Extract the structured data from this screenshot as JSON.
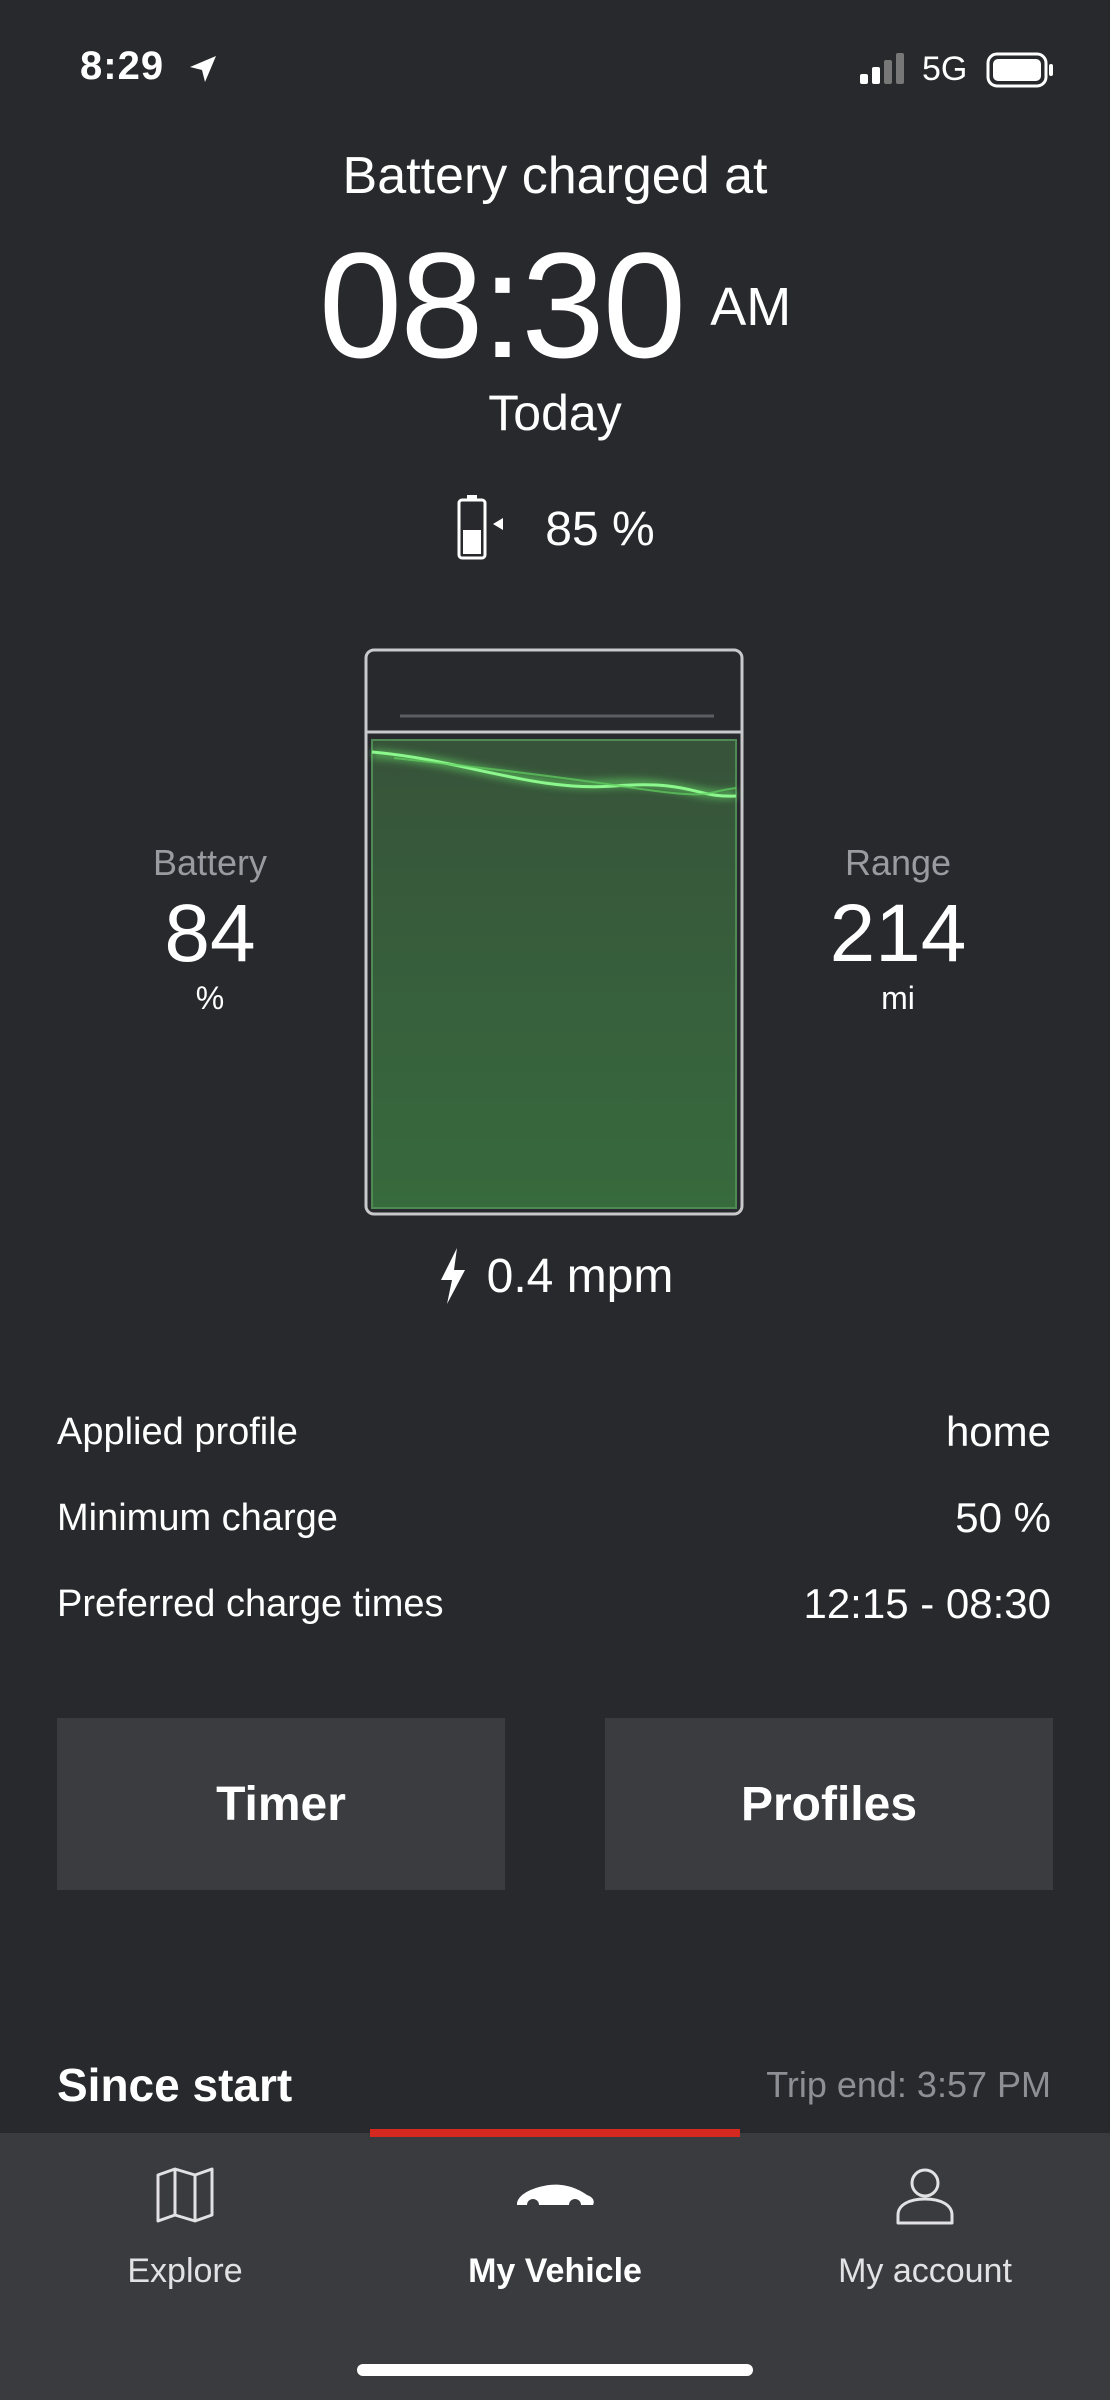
{
  "status_bar": {
    "time": "8:29",
    "network": "5G"
  },
  "header": {
    "title": "Battery charged at",
    "time": "08:30",
    "ampm": "AM",
    "day": "Today",
    "target_charge": "85 %"
  },
  "battery": {
    "label": "Battery",
    "value": "84",
    "unit": "%",
    "level": 0.84
  },
  "range": {
    "label": "Range",
    "value": "214",
    "unit": "mi"
  },
  "charge_rate": "0.4 mpm",
  "info": [
    {
      "label": "Applied profile",
      "value": "home"
    },
    {
      "label": "Minimum charge",
      "value": "50 %"
    },
    {
      "label": "Preferred charge times",
      "value": "12:15 - 08:30"
    }
  ],
  "buttons": {
    "timer": "Timer",
    "profiles": "Profiles"
  },
  "since": {
    "title": "Since start",
    "trip_end": "Trip end: 3:57 PM"
  },
  "nav": [
    {
      "label": "Explore",
      "icon": "map-icon",
      "active": false
    },
    {
      "label": "My Vehicle",
      "icon": "car-icon",
      "active": true
    },
    {
      "label": "My account",
      "icon": "person-icon",
      "active": false
    }
  ],
  "colors": {
    "accent": "#d5281e",
    "charge_green": "#3a6a40",
    "glow": "#6cf06c"
  }
}
